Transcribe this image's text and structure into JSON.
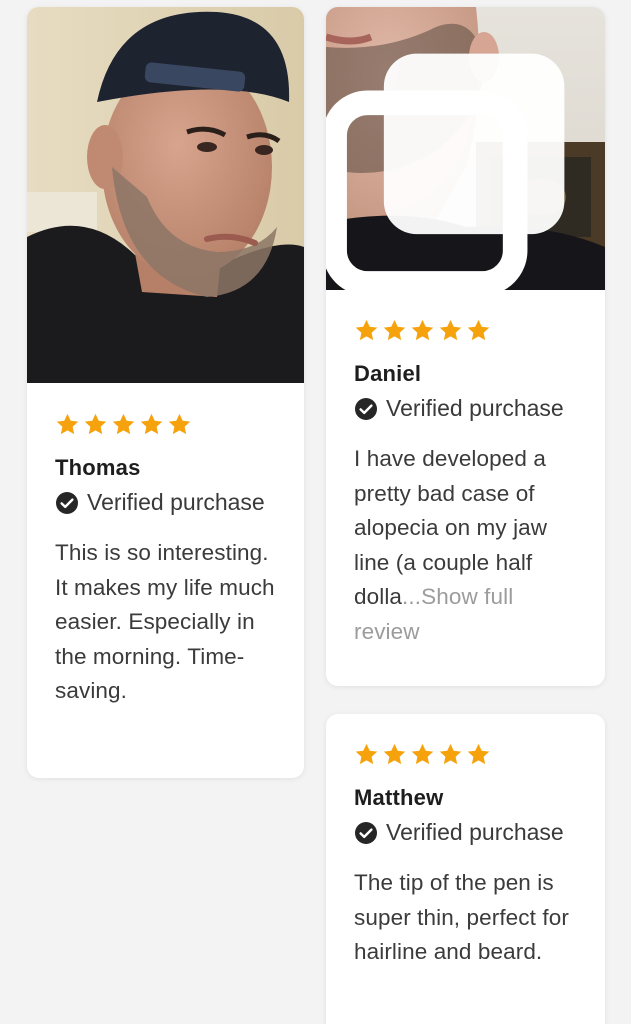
{
  "colors": {
    "star": "#F5A20C",
    "verified_icon": "#262626",
    "show_more": "#9C9C9C"
  },
  "reviews": [
    {
      "rating": 5,
      "name": "Thomas",
      "verified": "Verified purchase",
      "text": "This is so interesting. It makes my life much easier. Especially in the morning. Time-saving.",
      "photo": "photo of a man in a black backwards cap with a short beard"
    },
    {
      "rating": 5,
      "name": "Daniel",
      "verified": "Verified purchase",
      "text": "I have developed a pretty bad case of alopecia on my jaw line (a couple half dolla",
      "ellipsis": "...",
      "more": "Show full review",
      "photo": "close-up photo of a bearded jaw line",
      "media_icon": "multiple-photos-icon"
    },
    {
      "rating": 5,
      "name": "Matthew",
      "verified": "Verified purchase",
      "text": "The tip of the pen is super thin, perfect for hairline and beard."
    }
  ]
}
